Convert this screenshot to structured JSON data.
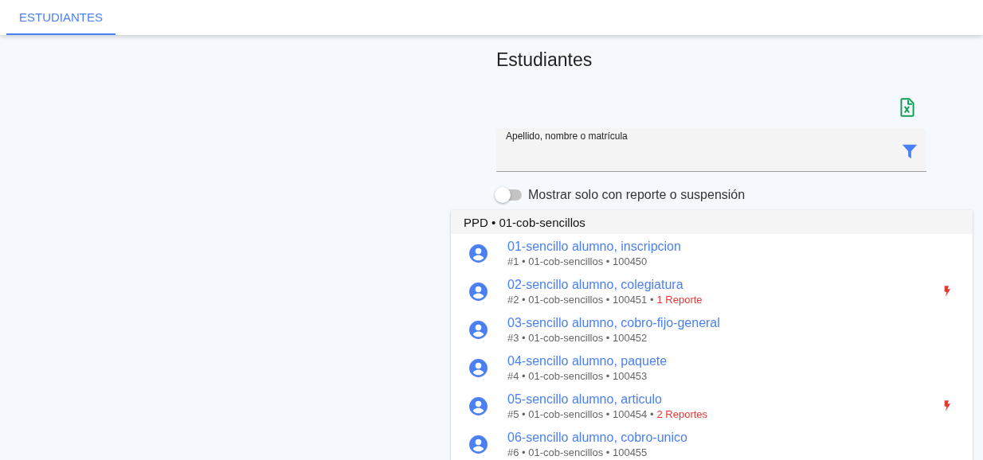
{
  "tabs": [
    {
      "label": "ESTUDIANTES",
      "selected": true
    }
  ],
  "page_title": "Estudiantes",
  "search": {
    "label": "Apellido, nombre o matrícula"
  },
  "toggle": {
    "label": "Mostrar solo con reporte o suspensión",
    "on": false
  },
  "group": {
    "header": "PPD • 01-cob-sencillos",
    "students": [
      {
        "name": "01-sencillo alumno, inscripcion",
        "meta": "#1 • 01-cob-sencillos • 100450",
        "flagged": false
      },
      {
        "name": "02-sencillo alumno, colegiatura",
        "meta": "#2 • 01-cob-sencillos • 100451 •",
        "report": "1 Reporte",
        "flagged": true
      },
      {
        "name": "03-sencillo alumno, cobro-fijo-general",
        "meta": "#3 • 01-cob-sencillos • 100452",
        "flagged": false
      },
      {
        "name": "04-sencillo alumno, paquete",
        "meta": "#4 • 01-cob-sencillos • 100453",
        "flagged": false
      },
      {
        "name": "05-sencillo alumno, articulo",
        "meta": "#5 • 01-cob-sencillos • 100454 •",
        "report": "2 Reportes",
        "flagged": true
      },
      {
        "name": "06-sencillo alumno, cobro-unico",
        "meta": "#6 • 01-cob-sencillos • 100455",
        "flagged": false
      }
    ]
  }
}
